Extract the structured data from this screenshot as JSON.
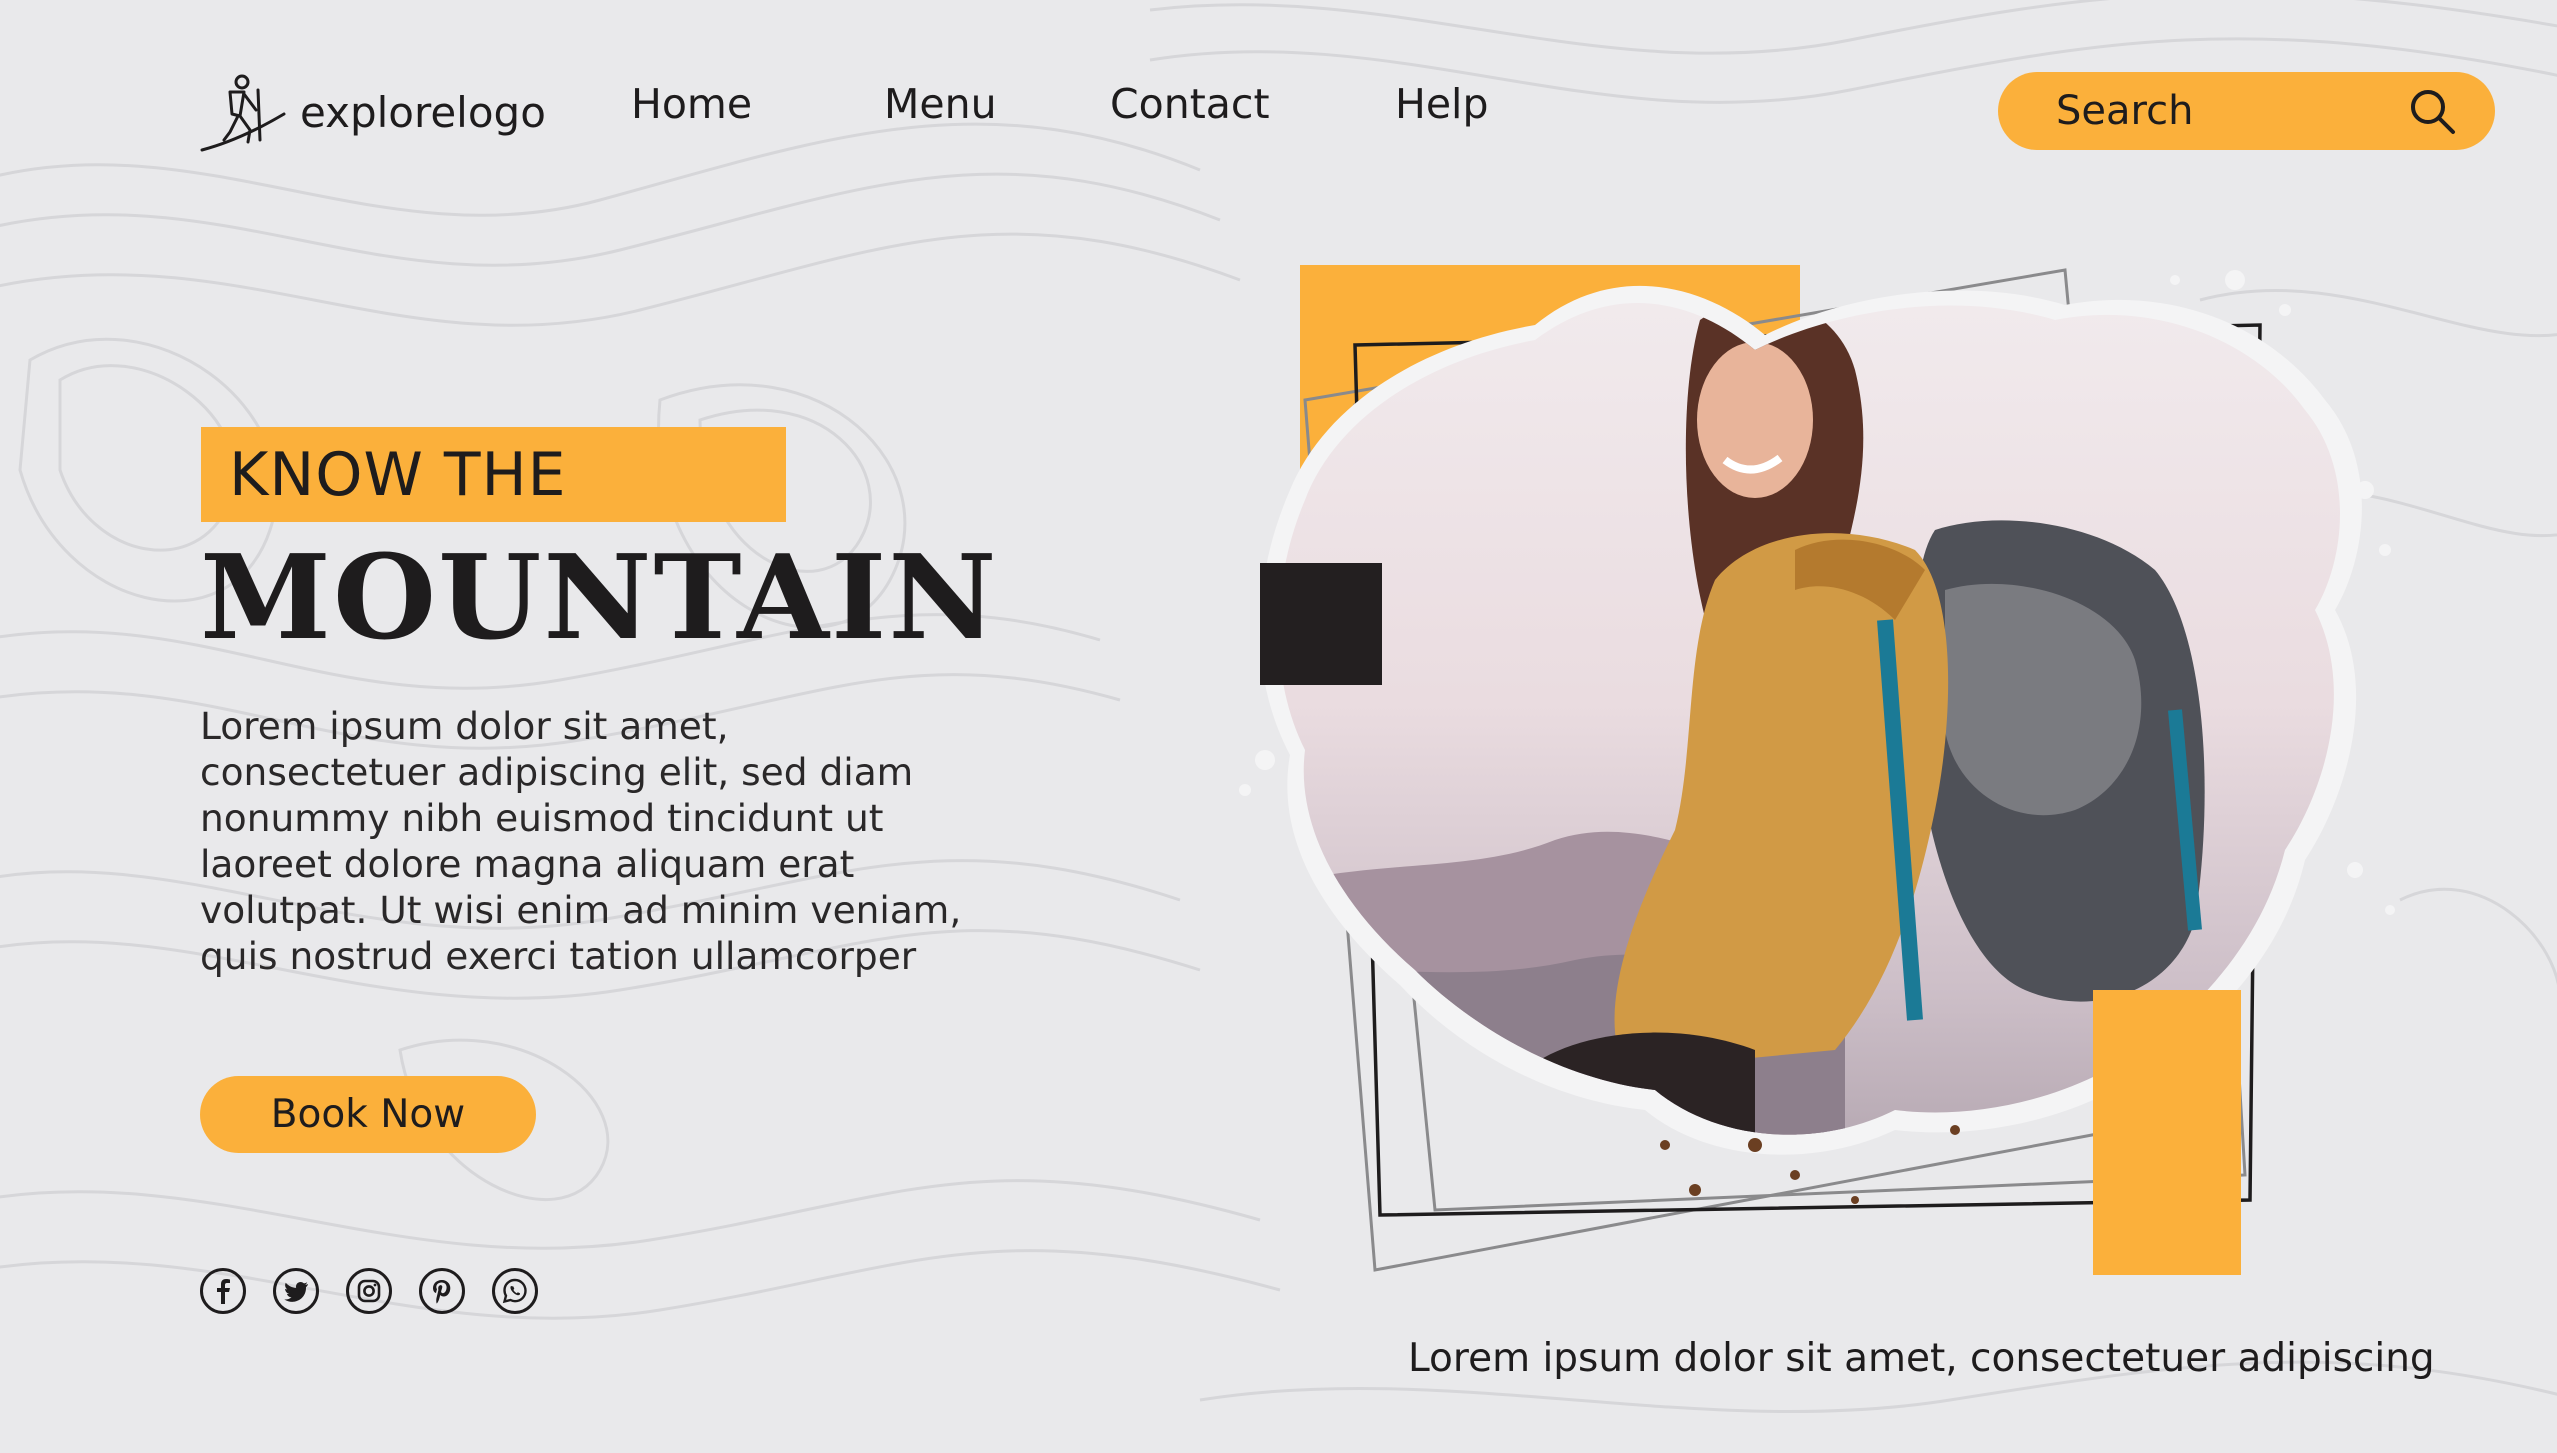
{
  "brand": {
    "logo_text": "explorelogo"
  },
  "nav": {
    "items": [
      "Home",
      "Menu",
      "Contact",
      "Help"
    ]
  },
  "search": {
    "placeholder": "Search"
  },
  "hero": {
    "kicker": "KNOW THE",
    "title": "MOUNTAIN",
    "body_lines": [
      "Lorem ipsum dolor sit amet,",
      "consectetuer adipiscing elit, sed diam",
      "nonummy nibh euismod tincidunt ut",
      "laoreet dolore magna aliquam erat",
      "volutpat. Ut wisi enim ad minim veniam,",
      "quis nostrud exerci tation ullamcorper"
    ],
    "cta_label": "Book Now"
  },
  "social": {
    "icons": [
      "facebook-icon",
      "twitter-icon",
      "instagram-icon",
      "pinterest-icon",
      "whatsapp-icon"
    ]
  },
  "caption": "Lorem ipsum dolor sit amet, consectetuer adipiscing",
  "colors": {
    "accent": "#fbb03b",
    "dark": "#1e1c1d",
    "background": "#e9e9eb"
  }
}
